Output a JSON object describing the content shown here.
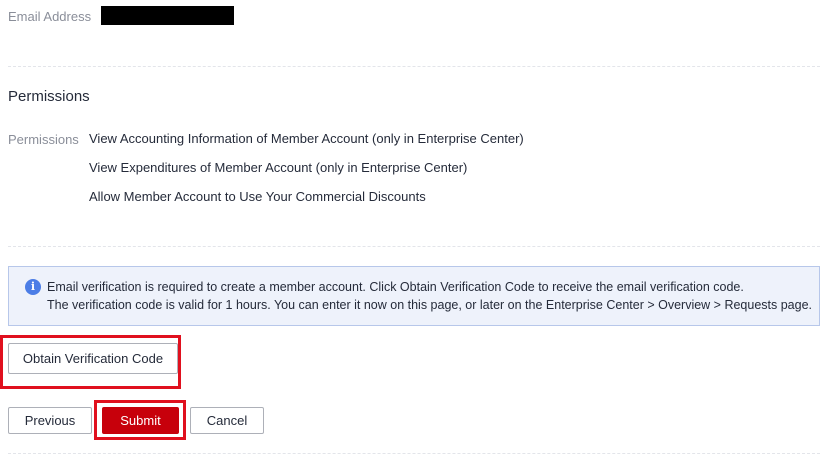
{
  "form": {
    "email_label": "Email Address",
    "email_value_redacted": true
  },
  "permissions": {
    "section_title": "Permissions",
    "field_label": "Permissions",
    "items": [
      "View Accounting Information of Member Account (only in Enterprise Center)",
      "View Expenditures of Member Account (only in Enterprise Center)",
      "Allow Member Account to Use Your Commercial Discounts"
    ]
  },
  "notice": {
    "icon": "info-icon",
    "line1": "Email verification is required to create a member account. Click Obtain Verification Code to receive the email verification code.",
    "line2": "The verification code is valid for 1 hours. You can enter it now on this page, or later on the Enterprise Center > Overview > Requests page."
  },
  "verification": {
    "obtain_label": "Obtain Verification Code"
  },
  "actions": {
    "previous_label": "Previous",
    "submit_label": "Submit",
    "cancel_label": "Cancel"
  },
  "colors": {
    "primary": "#c7000b",
    "highlight": "#e0101e",
    "info": "#4b7de6",
    "notice_bg": "#eef2fb",
    "notice_border": "#b7c7ea",
    "label": "#8a8e99"
  }
}
